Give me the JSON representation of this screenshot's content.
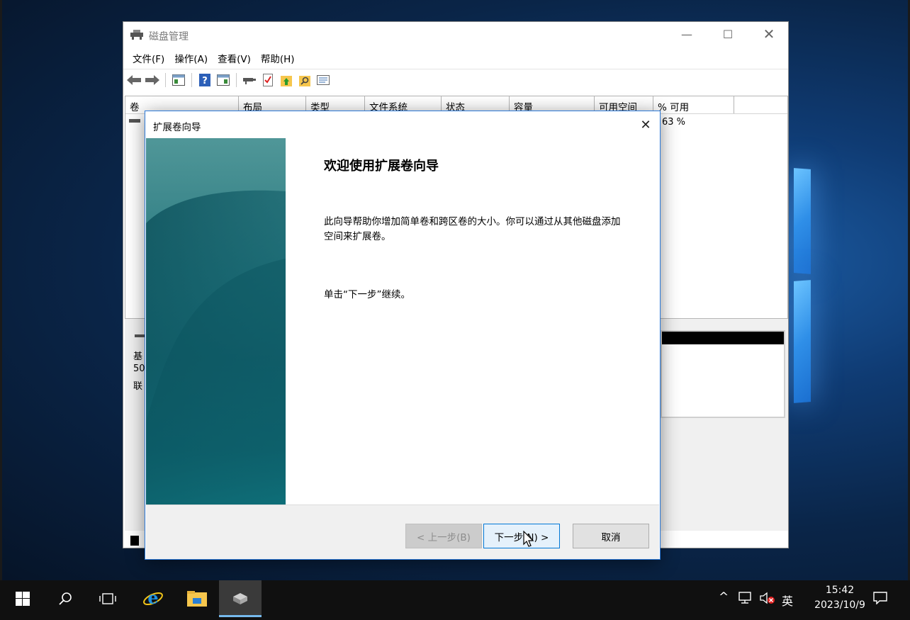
{
  "disk_management": {
    "title": "磁盘管理",
    "menu": [
      "文件(F)",
      "操作(A)",
      "查看(V)",
      "帮助(H)"
    ],
    "columns": [
      "卷",
      "布局",
      "类型",
      "文件系统",
      "状态",
      "容量",
      "可用空间",
      "% 可用"
    ],
    "row": {
      "percent_free": "63 %"
    },
    "lower_fragments": [
      "基",
      "50",
      "联"
    ]
  },
  "wizard": {
    "title": "扩展卷向导",
    "heading": "欢迎使用扩展卷向导",
    "description": "此向导帮助你增加简单卷和跨区卷的大小。你可以通过从其他磁盘添加空间来扩展卷。",
    "continue_text": "单击“下一步”继续。",
    "back_label": "< 上一步(B)",
    "next_label": "下一步(N) >",
    "cancel_label": "取消"
  },
  "taskbar": {
    "time": "15:42",
    "date": "2023/10/9",
    "ime": "英"
  },
  "icons": {
    "start": "windows-logo-icon",
    "search": "search-icon",
    "task_view": "task-view-icon",
    "ie": "internet-explorer-icon",
    "explorer": "file-explorer-icon",
    "disk_mgmt": "disk-management-icon"
  },
  "colors": {
    "accent": "#0078d7",
    "banner": "#0f5e6a"
  }
}
